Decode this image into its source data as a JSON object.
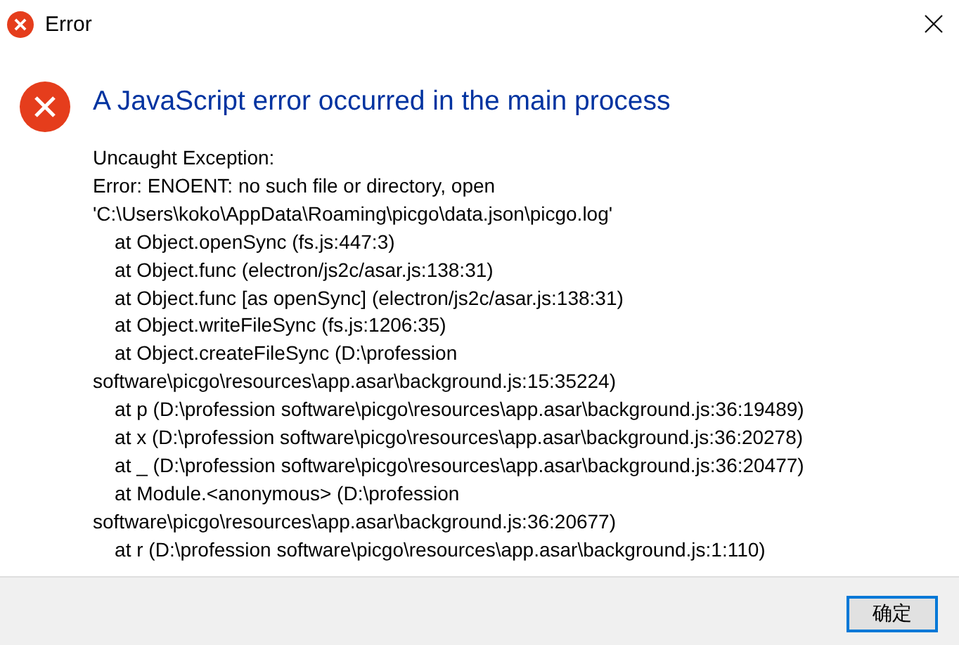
{
  "window": {
    "title": "Error"
  },
  "heading": "A JavaScript error occurred in the main process",
  "message": "Uncaught Exception:\nError: ENOENT: no such file or directory, open\n'C:\\Users\\koko\\AppData\\Roaming\\picgo\\data.json\\picgo.log'\n    at Object.openSync (fs.js:447:3)\n    at Object.func (electron/js2c/asar.js:138:31)\n    at Object.func [as openSync] (electron/js2c/asar.js:138:31)\n    at Object.writeFileSync (fs.js:1206:35)\n    at Object.createFileSync (D:\\profession\nsoftware\\picgo\\resources\\app.asar\\background.js:15:35224)\n    at p (D:\\profession software\\picgo\\resources\\app.asar\\background.js:36:19489)\n    at x (D:\\profession software\\picgo\\resources\\app.asar\\background.js:36:20278)\n    at _ (D:\\profession software\\picgo\\resources\\app.asar\\background.js:36:20477)\n    at Module.<anonymous> (D:\\profession\nsoftware\\picgo\\resources\\app.asar\\background.js:36:20677)\n    at r (D:\\profession software\\picgo\\resources\\app.asar\\background.js:1:110)",
  "buttons": [
    {
      "label": "确定"
    }
  ]
}
